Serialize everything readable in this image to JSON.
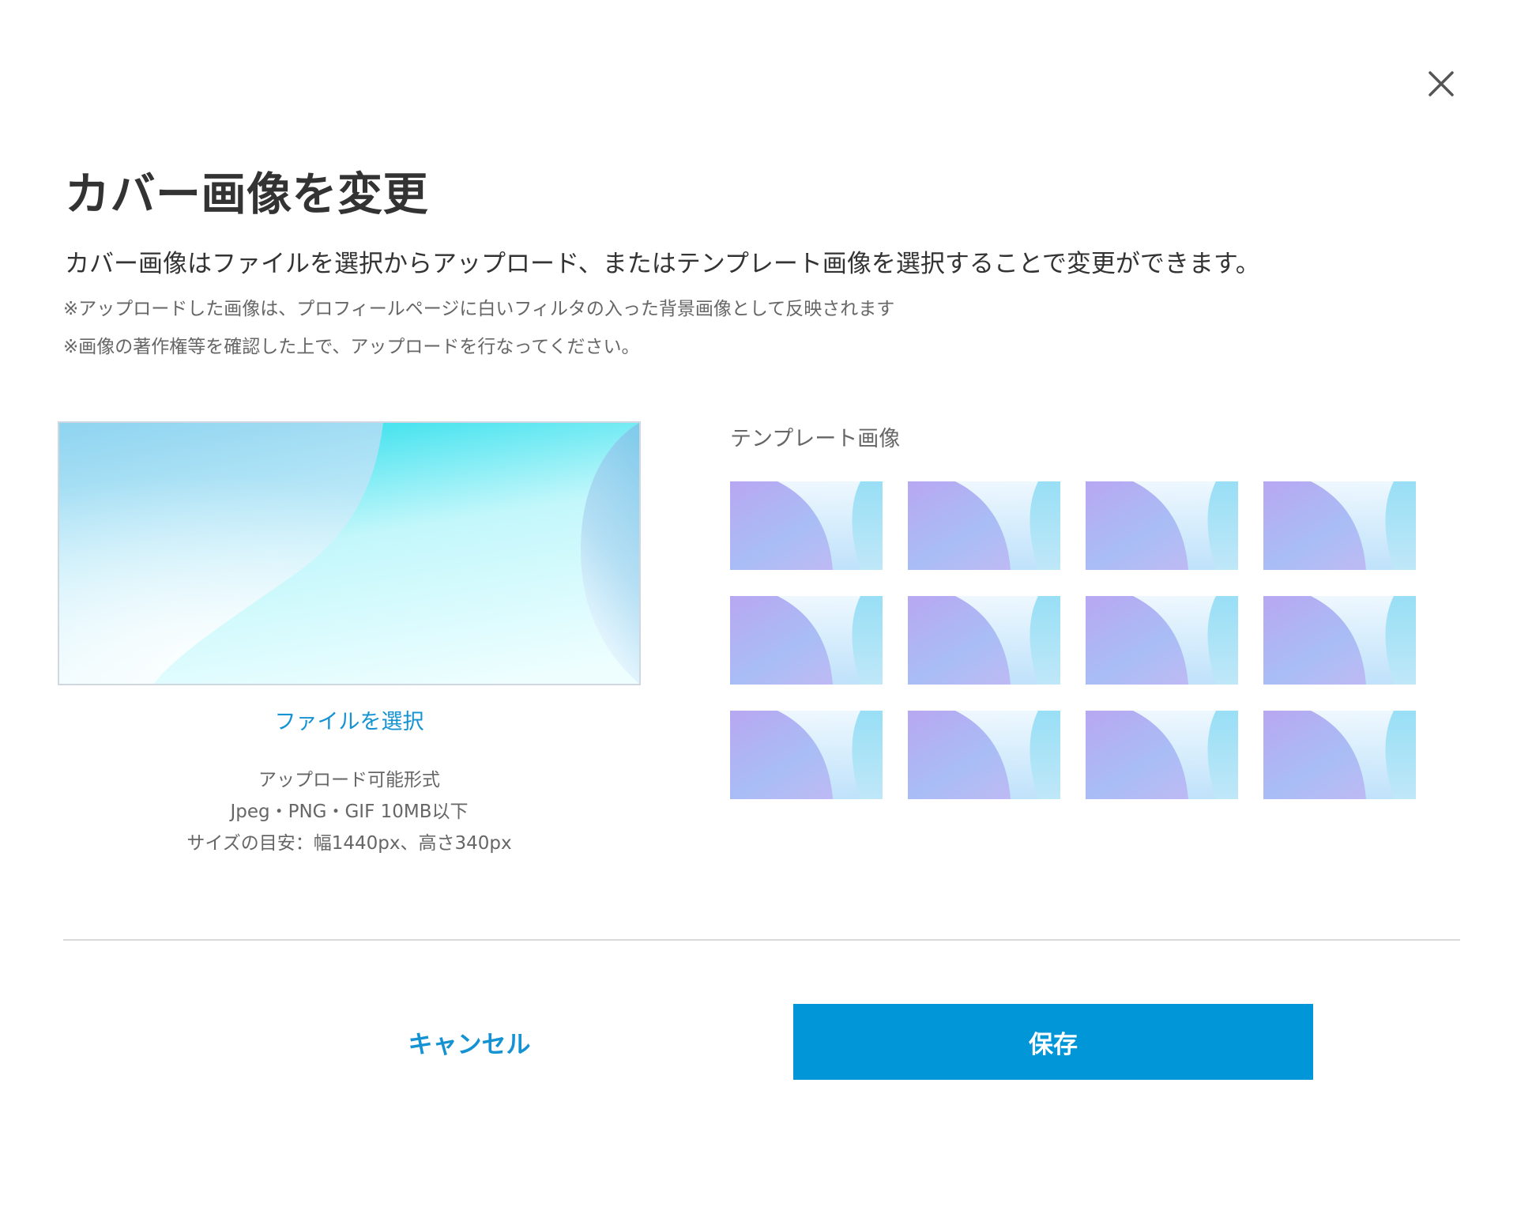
{
  "dialog": {
    "title": "カバー画像を変更",
    "description": "カバー画像はファイルを選択からアップロード、またはテンプレート画像を選択することで変更ができます。",
    "notes": [
      "※アップロードした画像は、プロフィールページに白いフィルタの入った背景画像として反映されます",
      "※画像の著作権等を確認した上で、アップロードを行なってください。"
    ],
    "close_icon": "close-icon"
  },
  "upload": {
    "select_file_label": "ファイルを選択",
    "format_title": "アップロード可能形式",
    "format_types": "Jpeg・PNG・GIF 10MB以下",
    "size_guide": "サイズの目安：幅1440px、高さ340px"
  },
  "templates": {
    "label": "テンプレート画像",
    "count": 12
  },
  "actions": {
    "cancel_label": "キャンセル",
    "save_label": "保存"
  },
  "colors": {
    "accent": "#0096d8",
    "link": "#1492d2",
    "text": "#333333",
    "muted": "#666666",
    "divider": "#d9d9d9"
  }
}
